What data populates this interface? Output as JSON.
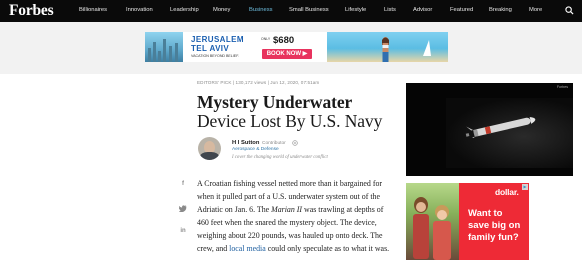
{
  "nav": {
    "logo": "Forbes",
    "items": [
      {
        "label": "Billionaires",
        "active": false
      },
      {
        "label": "Innovation",
        "active": false
      },
      {
        "label": "Leadership",
        "active": false
      },
      {
        "label": "Money",
        "active": false
      },
      {
        "label": "Business",
        "active": true
      },
      {
        "label": "Small Business",
        "active": false
      },
      {
        "label": "Lifestyle",
        "active": false
      },
      {
        "label": "Lists",
        "active": false
      },
      {
        "label": "Advisor",
        "active": false
      },
      {
        "label": "Featured",
        "active": false
      },
      {
        "label": "Breaking",
        "active": false
      },
      {
        "label": "More",
        "active": false
      }
    ],
    "search_icon": "search-icon",
    "accent_color": "#6fbfe0"
  },
  "banner_ad": {
    "line1": "JERUSALEM",
    "line2": "TEL AVIV",
    "tagline": "VACATION BEYOND BELIEF.",
    "price_prefix": "ONLY",
    "price": "$680",
    "cta": "BOOK NOW ▶"
  },
  "article": {
    "meta": "EDITORS' PICK  |  130,172 views  |  Jun 12, 2020, 07:51am",
    "title_line1": "Mystery Underwater",
    "title_line2": "Device Lost By U.S. Navy",
    "author": {
      "name": "H I Sutton",
      "role": "Contributor",
      "section": "Aerospace & Defense",
      "tagline": "I cover the changing world of underwater conflict"
    },
    "share_icons": [
      "facebook-icon",
      "twitter-icon",
      "linkedin-icon"
    ],
    "body": {
      "l1": "A Croatian fishing vessel netted more than it bargained for",
      "l2": "when it pulled part of a U.S. underwater system out of the",
      "l3a": "Adriatic on Jan. 6. The ",
      "l3b": "Marian II",
      "l3c": " was trawling at depths of",
      "l4": "460 feet when the snared the mystery object. The device,",
      "l5": "weighing about 220 pounds, was hauled up onto deck. The",
      "l6a": "crew, and ",
      "l6b": "local media",
      "l6c": " could only speculate as to what it was."
    }
  },
  "side_ads": {
    "video_brand": "Forbes",
    "dollar": {
      "logo": "dollar.",
      "line1": "Want to",
      "line2": "save big on",
      "line3": "family fun?"
    }
  }
}
